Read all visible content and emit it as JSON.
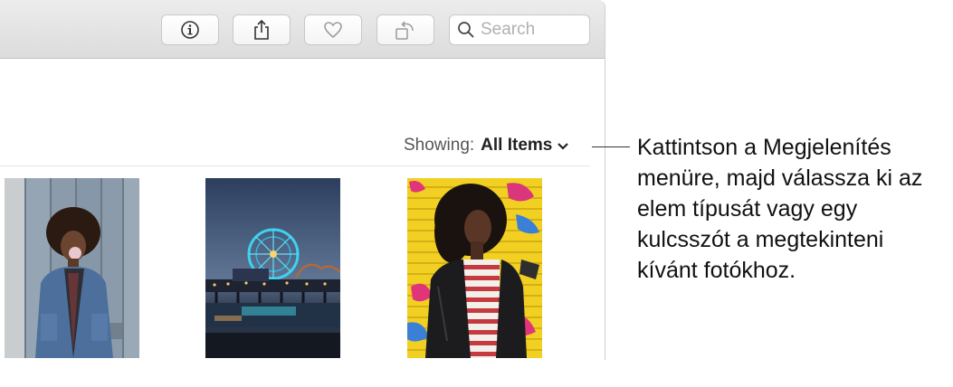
{
  "toolbar": {
    "info_button": {
      "icon": "info-icon"
    },
    "share_button": {
      "icon": "share-icon"
    },
    "favorite_button": {
      "icon": "heart-icon"
    },
    "rotate_button": {
      "icon": "rotate-icon"
    },
    "search": {
      "placeholder": "Search",
      "value": ""
    }
  },
  "filter": {
    "label": "Showing:",
    "value": "All Items"
  },
  "photos": [
    {
      "subject": "woman blowing bubble gum in front of wooden wall"
    },
    {
      "subject": "illuminated ferris wheel on pier at dusk"
    },
    {
      "subject": "woman in leather jacket against yellow graffiti shutter"
    }
  ],
  "callout": {
    "text": "Kattintson a Megjelenítés menüre, majd válassza ki az elem típusát vagy egy kulcsszót a megtekinteni kívánt fotókhoz."
  },
  "colors": {
    "toolbar_bg": "#dcdcdc",
    "text_dark": "#222222",
    "text_muted": "#555555",
    "accent_yellow": "#f2d023"
  }
}
